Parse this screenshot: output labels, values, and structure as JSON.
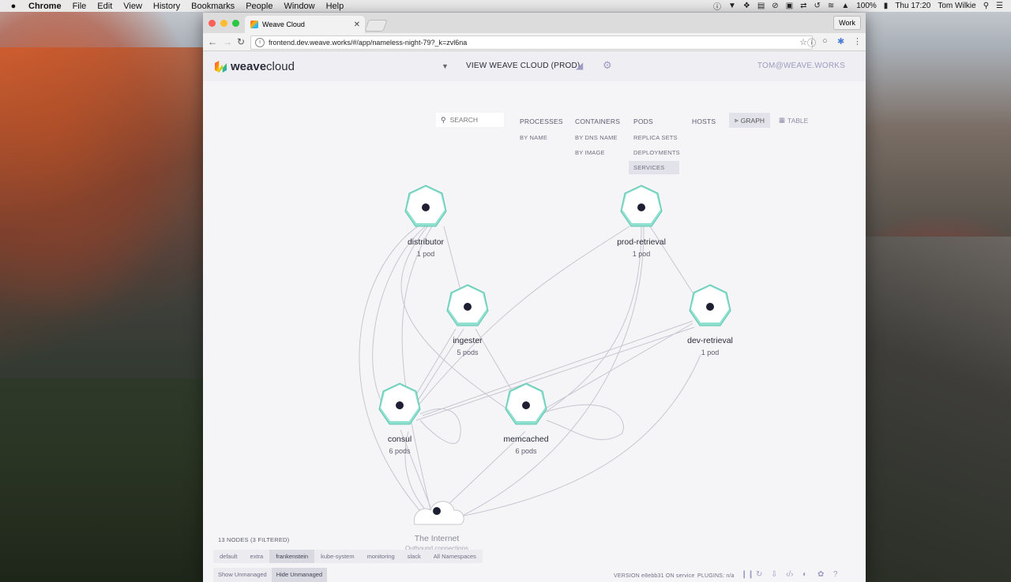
{
  "menubar": {
    "app_name": "Chrome",
    "items": [
      "File",
      "Edit",
      "View",
      "History",
      "Bookmarks",
      "People",
      "Window",
      "Help"
    ],
    "battery": "100%",
    "clock": "Thu 17:20",
    "user": "Tom Wilkie"
  },
  "browser": {
    "tab_title": "Weave Cloud",
    "url": "frontend.dev.weave.works/#/app/nameless-night-79?_k=zvl6na",
    "profile_button": "Work"
  },
  "app": {
    "logo_bold": "weave",
    "logo_light": "cloud",
    "view_title": "VIEW WEAVE CLOUD (PROD)",
    "user_email": "TOM@WEAVE.WORKS",
    "search_placeholder": "SEARCH",
    "topologies": {
      "processes": "PROCESSES",
      "by_name": "BY NAME",
      "containers": "CONTAINERS",
      "by_dns_name": "BY DNS NAME",
      "by_image": "BY IMAGE",
      "pods": "PODS",
      "replica_sets": "REPLICA SETS",
      "deployments": "DEPLOYMENTS",
      "services": "SERVICES",
      "hosts": "HOSTS"
    },
    "view_graph": "GRAPH",
    "view_table": "TABLE",
    "nodes": {
      "distributor": {
        "label": "distributor",
        "sub": "1 pod"
      },
      "prod_retrieval": {
        "label": "prod-retrieval",
        "sub": "1 pod"
      },
      "ingester": {
        "label": "ingester",
        "sub": "5 pods"
      },
      "dev_retrieval": {
        "label": "dev-retrieval",
        "sub": "1 pod"
      },
      "consul": {
        "label": "consul",
        "sub": "6 pods"
      },
      "memcached": {
        "label": "memcached",
        "sub": "6 pods"
      },
      "internet": {
        "label": "The Internet",
        "sub": "Outbound connections"
      }
    },
    "node_count": "13 NODES (3 FILTERED)",
    "namespaces": [
      "default",
      "extra",
      "frankenstein",
      "kube-system",
      "monitoring",
      "slack",
      "All Namespaces"
    ],
    "selected_namespace": "frankenstein",
    "unmanaged": [
      "Show Unmanaged",
      "Hide Unmanaged"
    ],
    "selected_unmanaged": "Hide Unmanaged",
    "version_text": "VERSION e8ebb31 ON service",
    "plugins_text": "PLUGINS: n/a"
  },
  "colors": {
    "node_teal": "#8fe0cf",
    "node_border": "#5ec7b2",
    "accent_purple": "#9b9bc0",
    "edge": "#c6c6d0"
  }
}
